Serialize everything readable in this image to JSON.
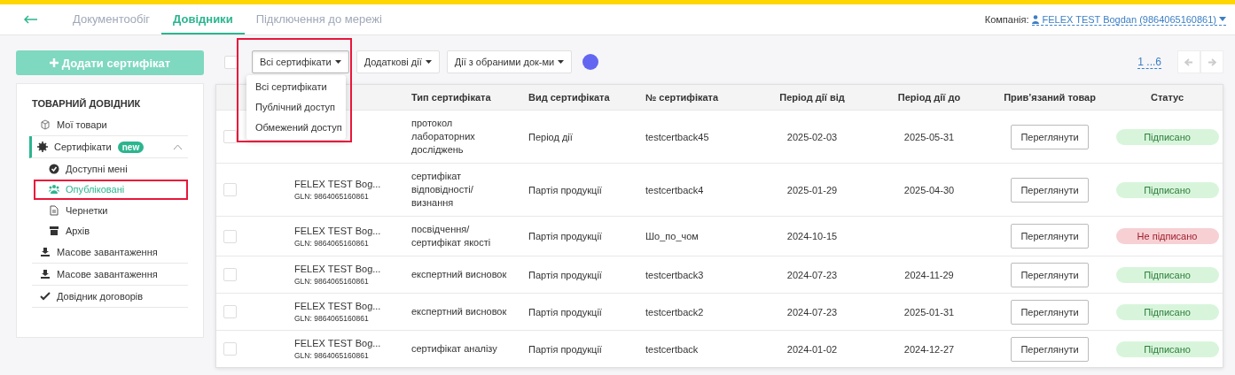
{
  "nav": {
    "tabs": [
      {
        "label": "Документообіг",
        "selected": false
      },
      {
        "label": "Довідники",
        "selected": true
      },
      {
        "label": "Підключення до мережі",
        "selected": false
      }
    ],
    "company_label": "Компанія:",
    "company": "FELEX TEST Bogdan (9864065160861)"
  },
  "add_button": "Додати сертифікат",
  "sidebar": {
    "title": "ТОВАРНИЙ ДОВІДНИК",
    "items": [
      {
        "label": "Мої товари",
        "active": false
      },
      {
        "label": "Сертифікати",
        "active": true,
        "badge": "new",
        "expanded": true,
        "children": [
          {
            "label": "Доступні мені",
            "selected": false,
            "highlighted": false
          },
          {
            "label": "Опубліковані",
            "selected": true,
            "highlighted": true
          },
          {
            "label": "Чернетки",
            "selected": false,
            "highlighted": false
          },
          {
            "label": "Архів",
            "selected": false,
            "highlighted": false
          }
        ]
      },
      {
        "label": "Масове завантаження",
        "active": false
      },
      {
        "label": "Масове завантаження",
        "active": false
      },
      {
        "label": "Довідник договорів",
        "active": false
      }
    ]
  },
  "toolbar": {
    "select_all_checked": false,
    "filter": {
      "label": "Всі сертифікати",
      "expanded": true,
      "highlighted": true,
      "options": [
        "Всі сертифікати",
        "Публічний доступ",
        "Обмежений доступ"
      ]
    },
    "buttons": [
      "Додаткові дії",
      "Дії з обраними док-ми"
    ],
    "pagination": "1 ...6"
  },
  "table": {
    "columns": [
      "Тип сертифіката",
      "Вид сертифіката",
      "№ сертифіката",
      "Період дії від",
      "Період дії до",
      "Прив’язаний товар",
      "Статус"
    ],
    "rows": [
      {
        "checked": false,
        "type": "протокол лабораторних досліджень",
        "kind": "Період дії",
        "number": "testcertback45",
        "from": "2025-02-03",
        "to": "2025-05-31",
        "action": "Переглянути",
        "status": "Підписано",
        "signed": true
      },
      {
        "checked": false,
        "owner": "FELEX TEST Bog...",
        "gln": "GLN: 9864065160861",
        "type": "сертифікат відповідності/ визнання",
        "kind": "Партія продукції",
        "number": "testcertback4",
        "from": "2025-01-29",
        "to": "2025-04-30",
        "action": "Переглянути",
        "status": "Підписано",
        "signed": true
      },
      {
        "checked": false,
        "owner": "FELEX TEST Bog...",
        "gln": "GLN: 9864065160861",
        "type": "посвідчення/ сертифікат якості",
        "kind": "Партія продукції",
        "number": "Шо_по_чом",
        "from": "2024-10-15",
        "action": "Переглянути",
        "status": "Не підписано",
        "signed": false
      },
      {
        "checked": false,
        "owner": "FELEX TEST Bog...",
        "gln": "GLN: 9864065160861",
        "type": "експертний висновок",
        "kind": "Партія продукції",
        "number": "testcertback3",
        "from": "2024-07-23",
        "to": "2024-11-29",
        "action": "Переглянути",
        "status": "Підписано",
        "signed": true
      },
      {
        "checked": false,
        "owner": "FELEX TEST Bog...",
        "gln": "GLN: 9864065160861",
        "type": "експертний висновок",
        "kind": "Партія продукції",
        "number": "testcertback2",
        "from": "2024-07-23",
        "to": "2025-01-31",
        "action": "Переглянути",
        "status": "Підписано",
        "signed": true
      },
      {
        "checked": false,
        "owner": "FELEX TEST Bog...",
        "gln": "GLN: 9864065160861",
        "type": "сертифікат аналізу",
        "kind": "Партія продукції",
        "number": "testcertback",
        "from": "2024-01-02",
        "to": "2024-12-27",
        "action": "Переглянути",
        "status": "Підписано",
        "signed": true
      }
    ]
  }
}
